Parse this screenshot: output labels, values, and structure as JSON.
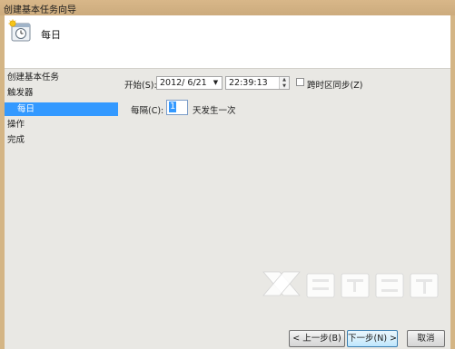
{
  "window": {
    "title": "创建基本任务向导"
  },
  "header": {
    "title": "每日",
    "icon": "task-scheduler-icon"
  },
  "steps": [
    {
      "label": "创建基本任务",
      "indent": false,
      "active": false
    },
    {
      "label": "触发器",
      "indent": false,
      "active": false
    },
    {
      "label": "每日",
      "indent": true,
      "active": true
    },
    {
      "label": "操作",
      "indent": false,
      "active": false
    },
    {
      "label": "完成",
      "indent": false,
      "active": false
    }
  ],
  "form": {
    "start_label": "开始(S):",
    "start_date": "2012/ 6/21",
    "start_time": "22:39:13",
    "sync_label": "跨时区同步(Z)",
    "sync_checked": false,
    "interval_label": "每隔(C):",
    "interval_value": "1",
    "interval_unit": "天发生一次"
  },
  "buttons": {
    "back": "< 上一步(B)",
    "next": "下一步(N) >",
    "cancel": "取消"
  },
  "colors": {
    "frame": "#d4b585",
    "selection": "#3399ff",
    "background": "#e9e8e4"
  }
}
